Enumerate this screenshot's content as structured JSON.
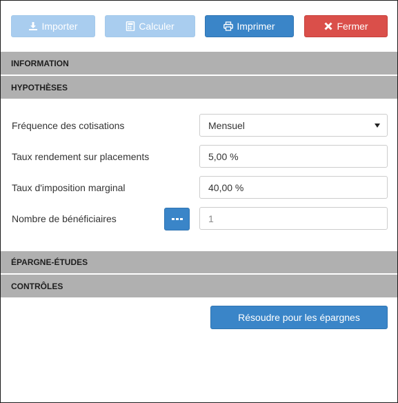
{
  "toolbar": {
    "import_label": "Importer",
    "calculate_label": "Calculer",
    "print_label": "Imprimer",
    "close_label": "Fermer"
  },
  "sections": {
    "information": "INFORMATION",
    "hypotheses": "HYPOTHÈSES",
    "epargne": "ÉPARGNE-ÉTUDES",
    "controles": "CONTRÔLES"
  },
  "form": {
    "frequency": {
      "label": "Fréquence des cotisations",
      "value": "Mensuel"
    },
    "yield": {
      "label": "Taux rendement sur placements",
      "value": "5,00 %"
    },
    "tax": {
      "label": "Taux d'imposition marginal",
      "value": "40,00 %"
    },
    "beneficiaries": {
      "label": "Nombre de bénéficiaires",
      "value": "1"
    }
  },
  "solve_button": "Résoudre pour les épargnes",
  "icons": {
    "import": "download-icon",
    "calculate": "calculator-icon",
    "print": "print-icon",
    "close": "close-icon",
    "ellipsis": "ellipsis-icon",
    "caret": "caret-down-icon"
  },
  "colors": {
    "primary": "#3a85c8",
    "primary_disabled": "#a9cdef",
    "danger": "#da4f4a",
    "section_bg": "#b0b0b0"
  }
}
